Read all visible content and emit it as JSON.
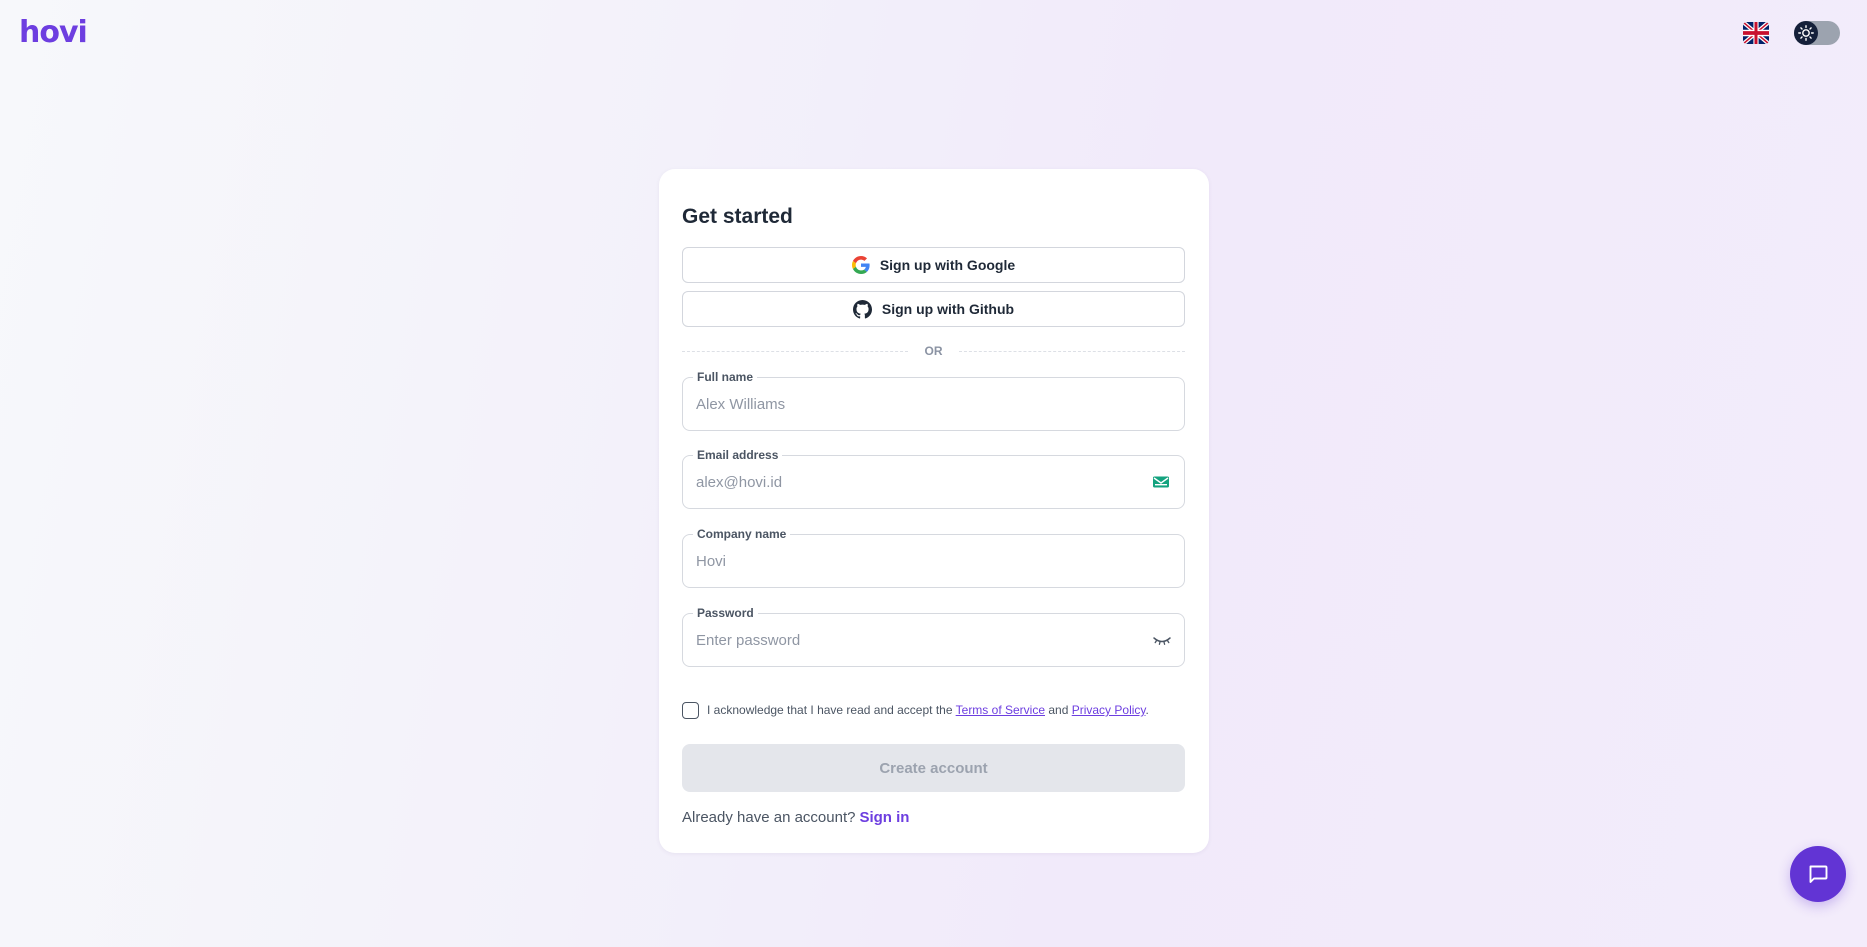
{
  "brand": {
    "logo_text": "hovi",
    "accent_color": "#6d3ee0"
  },
  "header": {
    "language_icon": "uk-flag-icon",
    "theme_toggle_icon": "sun-icon",
    "theme_mode": "light"
  },
  "card": {
    "title": "Get started",
    "oauth": {
      "google_label": "Sign up with Google",
      "google_icon": "google-icon",
      "github_label": "Sign up with Github",
      "github_icon": "github-icon"
    },
    "divider_text": "OR",
    "fields": {
      "full_name": {
        "label": "Full name",
        "placeholder": "Alex Williams",
        "value": ""
      },
      "email": {
        "label": "Email address",
        "placeholder": "alex@hovi.id",
        "value": "",
        "icon": "email-icon"
      },
      "company": {
        "label": "Company name",
        "placeholder": "Hovi",
        "value": ""
      },
      "password": {
        "label": "Password",
        "placeholder": "Enter password",
        "value": "",
        "icon": "eye-closed-icon"
      }
    },
    "acknowledge": {
      "checked": false,
      "prefix": "I acknowledge that I have read and accept the",
      "terms_link": "Terms of Service",
      "conjunction": "and",
      "privacy_link": "Privacy Policy",
      "suffix": "."
    },
    "submit_label": "Create account",
    "submit_disabled": true,
    "signin_prompt": "Already have an account?",
    "signin_link": "Sign in"
  },
  "chat": {
    "icon": "chat-bubble-icon",
    "color": "#6234d4"
  }
}
